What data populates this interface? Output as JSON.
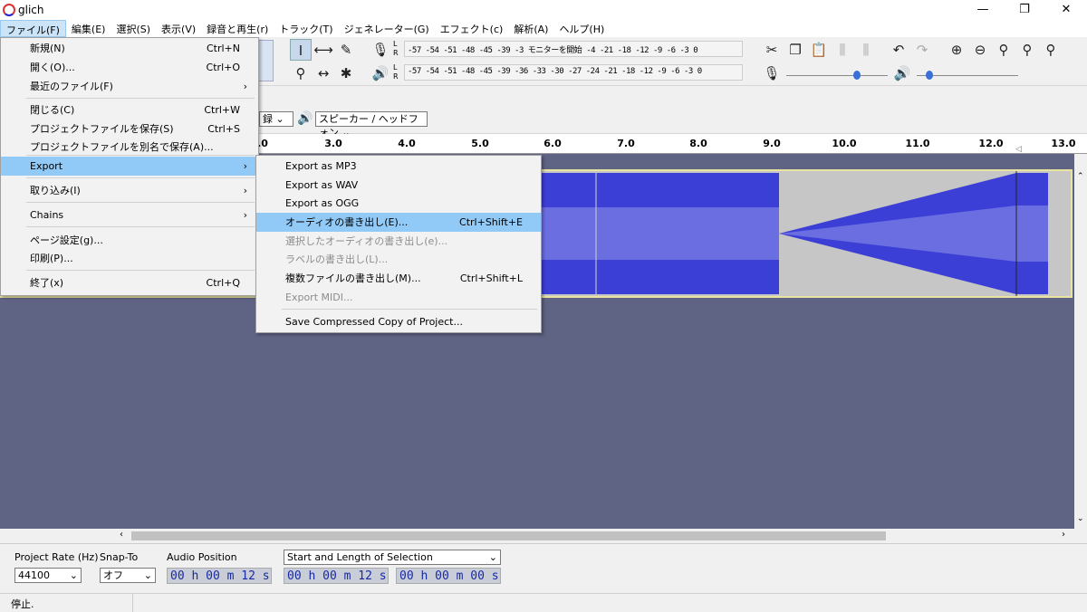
{
  "window": {
    "title": "glich",
    "min": "—",
    "restore": "❐",
    "close": "✕"
  },
  "menubar": [
    "ファイル(F)",
    "編集(E)",
    "選択(S)",
    "表示(V)",
    "録音と再生(r)",
    "トラック(T)",
    "ジェネレーター(G)",
    "エフェクト(c)",
    "解析(A)",
    "ヘルプ(H)"
  ],
  "meter": {
    "rec_scale": "-57 -54 -51 -48 -45  -39 -3 モニターを開始 -4 -21 -18  -12 -9  -6  -3  0",
    "play_scale": "-57 -54 -51 -48 -45  -39 -36 -33 -30 -27 -24 -21 -18  -12 -9  -6  -3  0",
    "L": "L",
    "R": "R"
  },
  "device": {
    "channels": "録",
    "output": "スピーカー / ヘッドフォン"
  },
  "ruler": [
    "3.0",
    "4.0",
    "5.0",
    "6.0",
    "7.0",
    "8.0",
    "9.0",
    "10.0",
    "11.0",
    "12.0",
    "13.0"
  ],
  "ruler_left": ".0",
  "file_menu": {
    "items": [
      {
        "label": "新規(N)",
        "shortcut": "Ctrl+N"
      },
      {
        "label": "開く(O)...",
        "shortcut": "Ctrl+O"
      },
      {
        "label": "最近のファイル(F)",
        "arrow": "›"
      },
      {
        "label": "閉じる(C)",
        "shortcut": "Ctrl+W"
      },
      {
        "label": "プロジェクトファイルを保存(S)",
        "shortcut": "Ctrl+S"
      },
      {
        "label": "プロジェクトファイルを別名で保存(A)..."
      },
      {
        "label": "Export",
        "arrow": "›"
      },
      {
        "label": "取り込み(I)",
        "arrow": "›"
      },
      {
        "label": "Chains",
        "arrow": "›"
      },
      {
        "label": "ページ設定(g)..."
      },
      {
        "label": "印刷(P)..."
      },
      {
        "label": "終了(x)",
        "shortcut": "Ctrl+Q"
      }
    ]
  },
  "export_menu": {
    "items": [
      {
        "label": "Export as MP3"
      },
      {
        "label": "Export as WAV"
      },
      {
        "label": "Export as OGG"
      },
      {
        "label": "オーディオの書き出し(E)...",
        "shortcut": "Ctrl+Shift+E"
      },
      {
        "label": "選択したオーディオの書き出し(e)..."
      },
      {
        "label": "ラベルの書き出し(L)..."
      },
      {
        "label": "複数ファイルの書き出し(M)...",
        "shortcut": "Ctrl+Shift+L"
      },
      {
        "label": "Export MIDI..."
      },
      {
        "label": "Save Compressed Copy of Project..."
      }
    ]
  },
  "selection_toolbar": {
    "project_rate_label": "Project Rate (Hz)",
    "project_rate": "44100",
    "snap_label": "Snap-To",
    "snap": "オフ",
    "audio_pos_label": "Audio Position",
    "audio_pos": "00 h 00 m 12 s",
    "sel_mode": "Start and Length of Selection",
    "sel_start": "00 h 00 m 12 s",
    "sel_len": "00 h 00 m 00 s"
  },
  "status": "停止.",
  "colors": {
    "waveform": "#3b3fd6",
    "waveform_rms": "#6a6ee0",
    "track_bg": "#c6c6c6",
    "workspace": "#5f6384",
    "highlight": "#91c9f7"
  }
}
